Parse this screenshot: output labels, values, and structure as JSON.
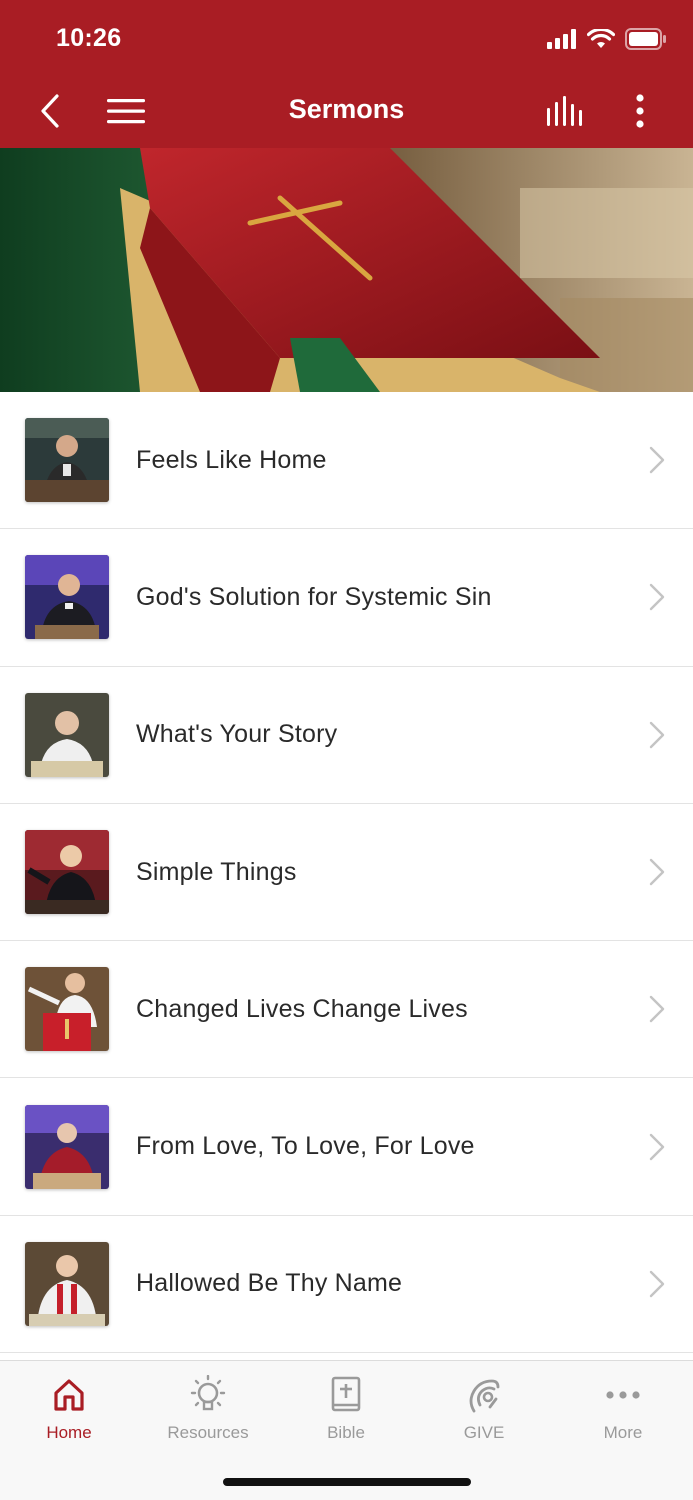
{
  "status_bar": {
    "time": "10:26"
  },
  "header": {
    "title": "Sermons"
  },
  "sermons": [
    {
      "title": "Feels Like Home"
    },
    {
      "title": "God's Solution for Systemic Sin"
    },
    {
      "title": "What's Your Story"
    },
    {
      "title": "Simple Things"
    },
    {
      "title": "Changed Lives Change Lives"
    },
    {
      "title": "From Love, To Love, For Love"
    },
    {
      "title": "Hallowed Be Thy Name"
    }
  ],
  "tabbar": {
    "tabs": [
      {
        "label": "Home",
        "icon": "home-icon",
        "active": true
      },
      {
        "label": "Resources",
        "icon": "lightbulb-icon"
      },
      {
        "label": "Bible",
        "icon": "bible-icon"
      },
      {
        "label": "GIVE",
        "icon": "give-icon"
      },
      {
        "label": "More",
        "icon": "more-dots-icon"
      }
    ]
  },
  "colors": {
    "brand": "#a91d24",
    "tab_inactive": "#9a9a9a"
  }
}
